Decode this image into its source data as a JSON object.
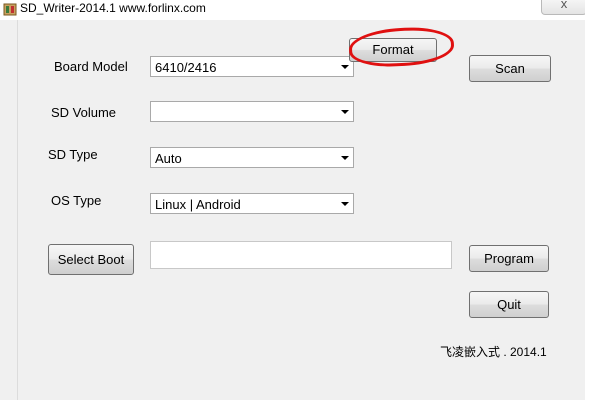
{
  "window": {
    "title": "SD_Writer-2014.1    www.forlinx.com",
    "close_glyph": "x"
  },
  "form": {
    "board_model": {
      "label": "Board Model",
      "value": "6410/2416"
    },
    "sd_volume": {
      "label": "SD Volume",
      "value": ""
    },
    "sd_type": {
      "label": "SD Type",
      "value": "Auto"
    },
    "os_type": {
      "label": "OS Type",
      "value": "Linux | Android"
    },
    "boot_path": {
      "value": ""
    }
  },
  "buttons": {
    "format": "Format",
    "scan": "Scan",
    "select_boot": "Select Boot",
    "program": "Program",
    "quit": "Quit"
  },
  "footer": {
    "copyright": "飞凌嵌入式 . 2014.1"
  },
  "annotation": {
    "color": "#e01010",
    "target": "format-button"
  }
}
